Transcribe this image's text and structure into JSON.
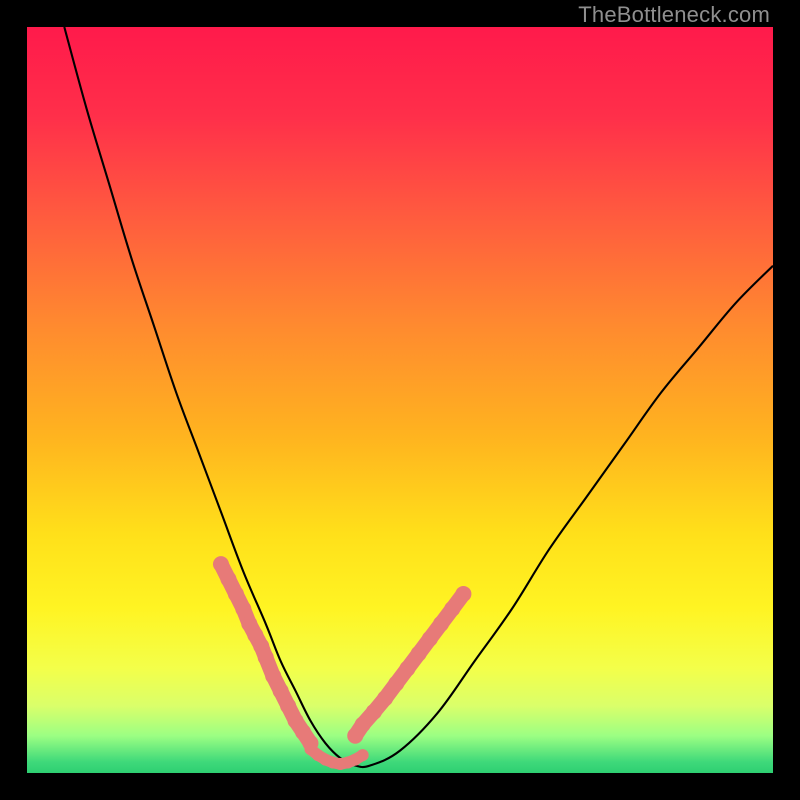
{
  "watermark": "TheBottleneck.com",
  "chart_data": {
    "type": "line",
    "title": "",
    "xlabel": "",
    "ylabel": "",
    "xlim": [
      0,
      100
    ],
    "ylim": [
      0,
      100
    ],
    "grid": false,
    "legend": false,
    "series": [
      {
        "name": "bottleneck-curve",
        "x": [
          5,
          8,
          11,
          14,
          17,
          20,
          23,
          26,
          29,
          32,
          34,
          36,
          38,
          40,
          42,
          44,
          46,
          50,
          55,
          60,
          65,
          70,
          75,
          80,
          85,
          90,
          95,
          100
        ],
        "y": [
          100,
          89,
          79,
          69,
          60,
          51,
          43,
          35,
          27,
          20,
          15,
          11,
          7,
          4,
          2,
          1,
          1,
          3,
          8,
          15,
          22,
          30,
          37,
          44,
          51,
          57,
          63,
          68
        ]
      },
      {
        "name": "marker-dots-left",
        "x": [
          26,
          27,
          28,
          29,
          29.8,
          30.6,
          31.4,
          32,
          33,
          34,
          35,
          36,
          37,
          38
        ],
        "y": [
          28,
          26,
          24,
          22,
          20,
          18.5,
          17,
          15.5,
          13,
          11,
          9,
          7,
          5.5,
          4
        ]
      },
      {
        "name": "marker-dots-right",
        "x": [
          44,
          45,
          46.5,
          48,
          49.5,
          51,
          52.5,
          54,
          55.5,
          57,
          58.5
        ],
        "y": [
          5,
          6.5,
          8.2,
          10,
          12,
          14,
          16,
          18,
          20,
          22,
          24
        ]
      },
      {
        "name": "marker-dots-bottom",
        "x": [
          38,
          39,
          40,
          41,
          42,
          43,
          44,
          45
        ],
        "y": [
          3.2,
          2.4,
          1.8,
          1.4,
          1.2,
          1.4,
          1.8,
          2.4
        ]
      }
    ],
    "background_gradient": {
      "stops": [
        {
          "offset": 0.0,
          "color": "#ff1a4b"
        },
        {
          "offset": 0.12,
          "color": "#ff2f4a"
        },
        {
          "offset": 0.25,
          "color": "#ff5a3f"
        },
        {
          "offset": 0.4,
          "color": "#ff8a2f"
        },
        {
          "offset": 0.55,
          "color": "#ffb41f"
        },
        {
          "offset": 0.68,
          "color": "#ffe01a"
        },
        {
          "offset": 0.78,
          "color": "#fff423"
        },
        {
          "offset": 0.86,
          "color": "#f3ff4a"
        },
        {
          "offset": 0.91,
          "color": "#daff6a"
        },
        {
          "offset": 0.95,
          "color": "#9cff83"
        },
        {
          "offset": 0.985,
          "color": "#3fd97a"
        },
        {
          "offset": 1.0,
          "color": "#2ecf72"
        }
      ]
    },
    "marker_style": {
      "color": "#e77a78",
      "radius_px_small": 6,
      "radius_px_large": 8
    }
  }
}
